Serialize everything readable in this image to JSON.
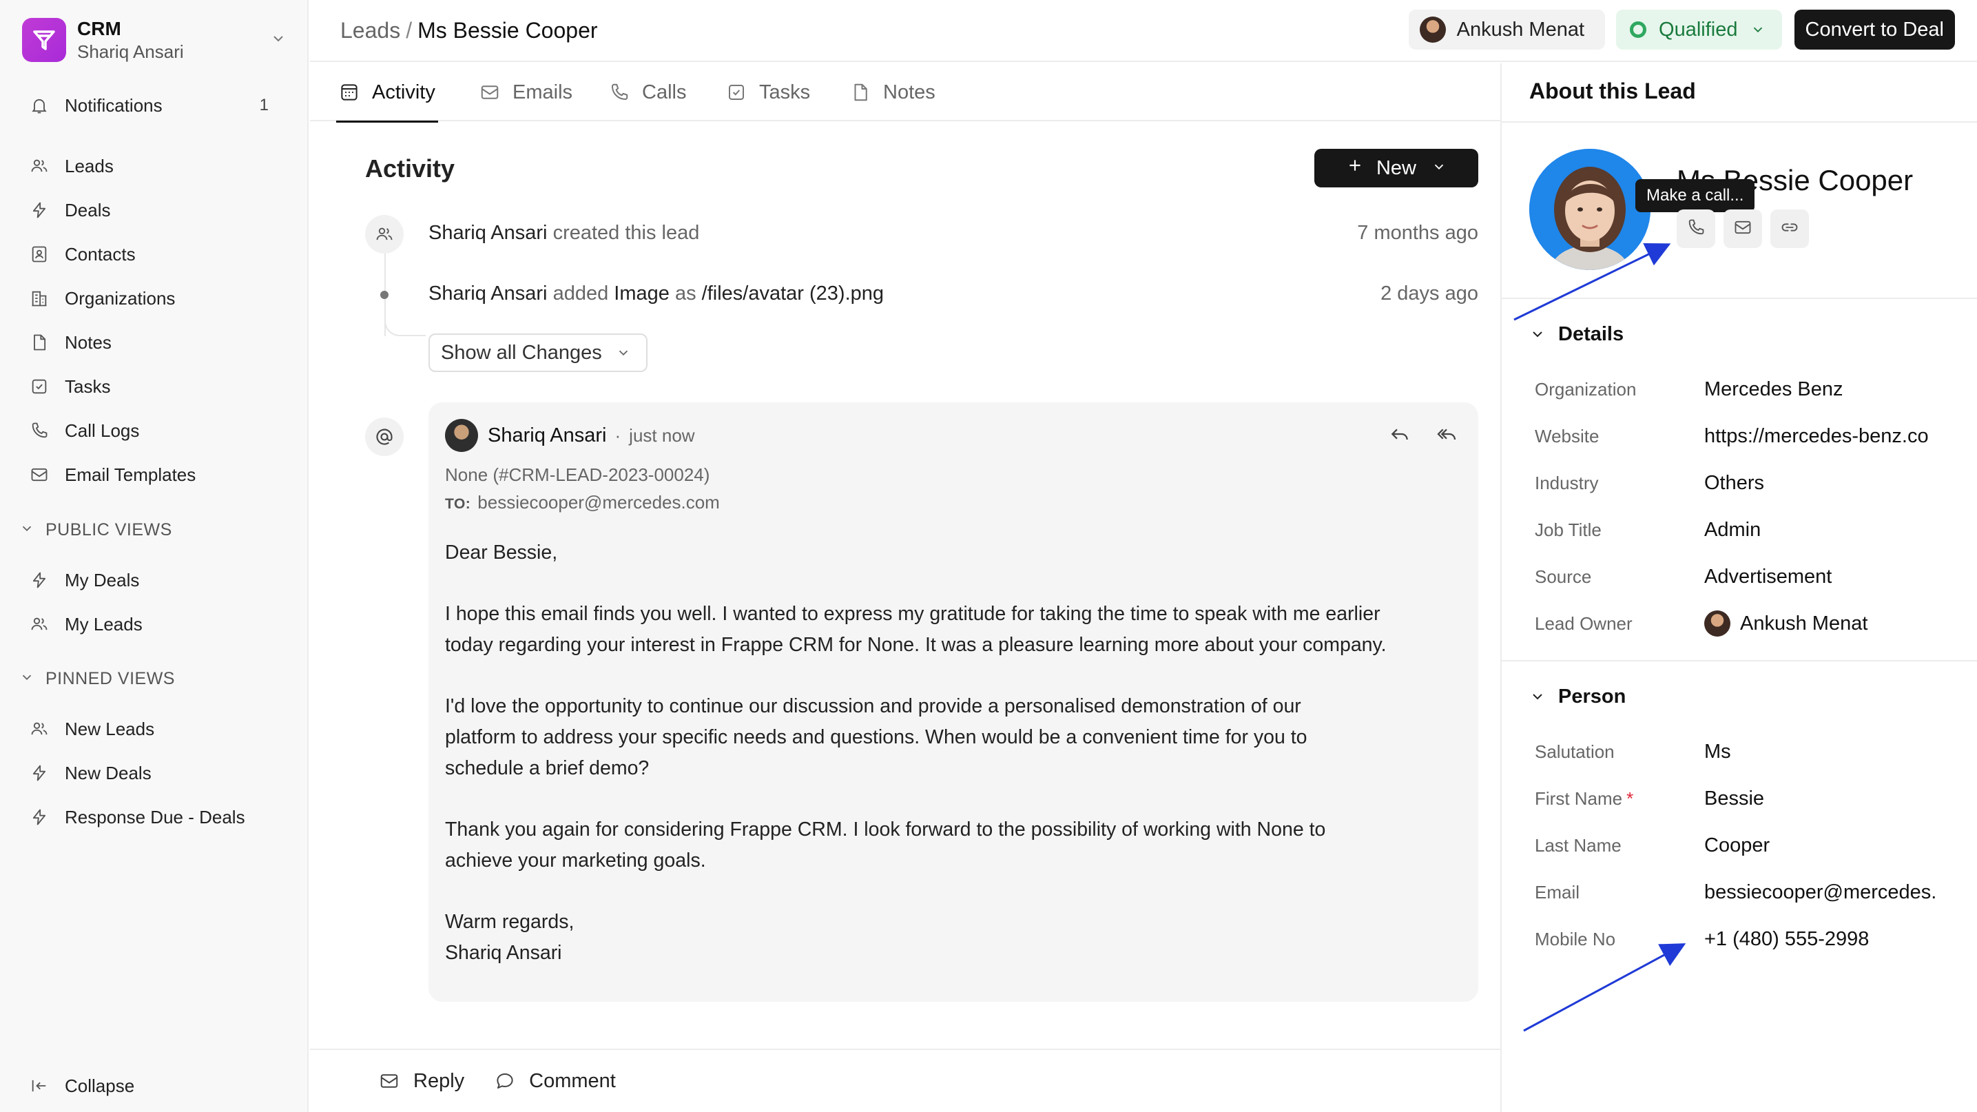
{
  "app": {
    "name": "CRM",
    "user": "Shariq Ansari"
  },
  "sidebar": {
    "notifications": {
      "label": "Notifications",
      "count": "1"
    },
    "items": [
      {
        "label": "Leads",
        "icon": "users-icon"
      },
      {
        "label": "Deals",
        "icon": "lightning-icon"
      },
      {
        "label": "Contacts",
        "icon": "contact-card-icon"
      },
      {
        "label": "Organizations",
        "icon": "building-icon"
      },
      {
        "label": "Notes",
        "icon": "file-icon"
      },
      {
        "label": "Tasks",
        "icon": "checkbox-icon"
      },
      {
        "label": "Call Logs",
        "icon": "phone-icon"
      },
      {
        "label": "Email Templates",
        "icon": "mail-icon"
      }
    ],
    "public_views": {
      "title": "PUBLIC VIEWS",
      "items": [
        "My Deals",
        "My Leads"
      ]
    },
    "pinned_views": {
      "title": "PINNED VIEWS",
      "items": [
        "New Leads",
        "New Deals",
        "Response Due - Deals"
      ]
    },
    "collapse": "Collapse"
  },
  "header": {
    "crumb_parent": "Leads",
    "crumb_sep": "/",
    "crumb_current": "Ms Bessie Cooper",
    "owner": "Ankush Menat",
    "status": "Qualified",
    "convert": "Convert to Deal",
    "status_color": "#2fa860"
  },
  "tabs": [
    "Activity",
    "Emails",
    "Calls",
    "Tasks",
    "Notes"
  ],
  "activity": {
    "title": "Activity",
    "new_button": "New",
    "events": [
      {
        "actor": "Shariq Ansari",
        "text": "created this lead",
        "time": "7 months ago"
      },
      {
        "actor": "Shariq Ansari",
        "verb": "added",
        "field": "Image",
        "as": "as",
        "value": "/files/avatar (23).png",
        "time": "2 days ago"
      }
    ],
    "show_changes": "Show all Changes",
    "email": {
      "sender": "Shariq Ansari",
      "dot": "·",
      "time": "just now",
      "subject": "None (#CRM-LEAD-2023-00024)",
      "to_label": "TO:",
      "to": "bessiecooper@mercedes.com",
      "body": {
        "greeting": "Dear Bessie,",
        "p1_l1": "I hope this email finds you well. I wanted to express my gratitude for taking the time to speak with me earlier",
        "p1_l2": "today regarding your interest in Frappe CRM for None. It was a pleasure learning more about your company.",
        "p2_l1": "I'd love the opportunity to continue our discussion and provide a personalised demonstration of our",
        "p2_l2": "platform to address your specific needs and questions. When would be a convenient time for you to",
        "p2_l3": "schedule a brief demo?",
        "p3_l1": "Thank you again for considering Frappe CRM. I look forward to the possibility of working with None to",
        "p3_l2": "achieve your marketing goals.",
        "sign1": "Warm regards,",
        "sign2": "Shariq Ansari"
      }
    }
  },
  "footer": {
    "reply": "Reply",
    "comment": "Comment"
  },
  "right_panel": {
    "title": "About this Lead",
    "name": "Ms Bessie Cooper",
    "tooltip": "Make a call...",
    "details": {
      "title": "Details",
      "fields": [
        {
          "label": "Organization",
          "value": "Mercedes Benz"
        },
        {
          "label": "Website",
          "value": "https://mercedes-benz.co"
        },
        {
          "label": "Industry",
          "value": "Others"
        },
        {
          "label": "Job Title",
          "value": "Admin"
        },
        {
          "label": "Source",
          "value": "Advertisement"
        },
        {
          "label": "Lead Owner",
          "value": "Ankush Menat"
        }
      ]
    },
    "person": {
      "title": "Person",
      "fields": [
        {
          "label": "Salutation",
          "value": "Ms"
        },
        {
          "label": "First Name",
          "value": "Bessie",
          "required": "*"
        },
        {
          "label": "Last Name",
          "value": "Cooper"
        },
        {
          "label": "Email",
          "value": "bessiecooper@mercedes."
        },
        {
          "label": "Mobile No",
          "value": "+1 (480) 555-2998"
        }
      ]
    }
  }
}
